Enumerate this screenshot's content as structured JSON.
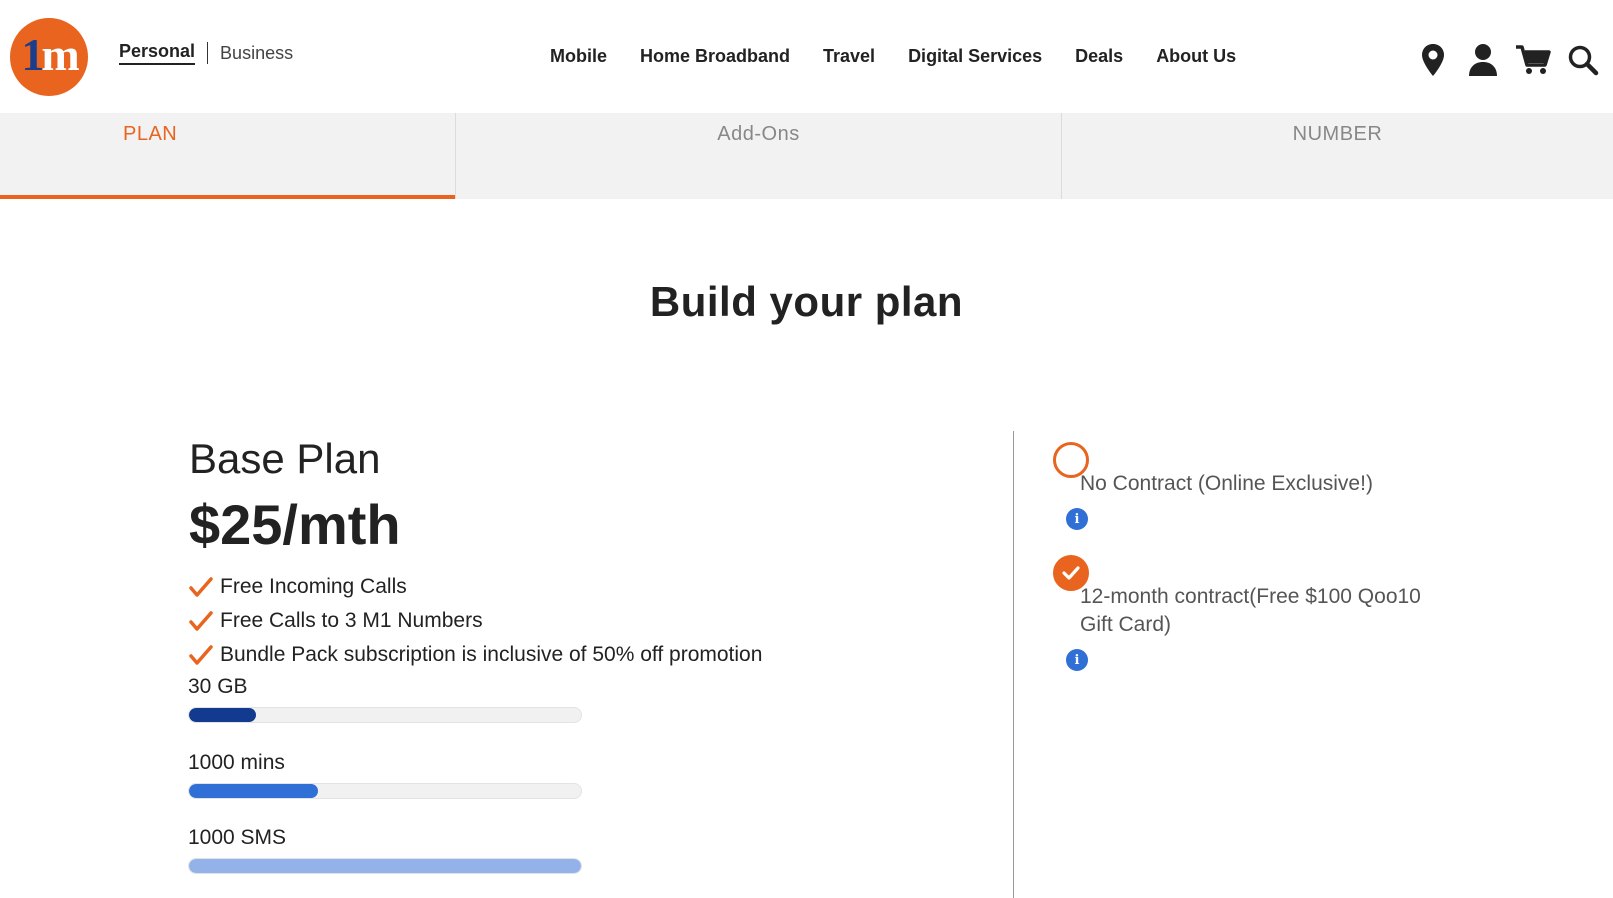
{
  "header": {
    "logo_text": "1m",
    "segments": {
      "personal": "Personal",
      "business": "Business"
    },
    "nav": [
      "Mobile",
      "Home Broadband",
      "Travel",
      "Digital Services",
      "Deals",
      "About Us"
    ],
    "icons": [
      "location-pin-icon",
      "user-icon",
      "cart-icon",
      "search-icon"
    ]
  },
  "steps": [
    "PLAN",
    "Add-Ons",
    "NUMBER"
  ],
  "page_title": "Build your plan",
  "plan": {
    "name": "Base Plan",
    "price": "$25/mth",
    "features": [
      "Free Incoming Calls",
      "Free Calls to 3 M1 Numbers",
      "Bundle Pack subscription is inclusive of 50% off promotion"
    ],
    "allowances": [
      {
        "label": "30 GB",
        "fraction": 0.17,
        "color": "#123a8f"
      },
      {
        "label": "1000 mins",
        "fraction": 0.33,
        "color": "#2f6fd6"
      },
      {
        "label": "1000 SMS",
        "fraction": 1.0,
        "color": "#93b2ea"
      }
    ]
  },
  "contract_options": [
    {
      "label": "No Contract (Online Exclusive!)",
      "selected": false
    },
    {
      "label": "12-month contract(Free $100 Qoo10 Gift Card)",
      "selected": true
    }
  ],
  "info_glyph": "i",
  "colors": {
    "accent": "#e8641f",
    "info": "#2f6fd6",
    "brand_blue": "#1a3d8c"
  }
}
